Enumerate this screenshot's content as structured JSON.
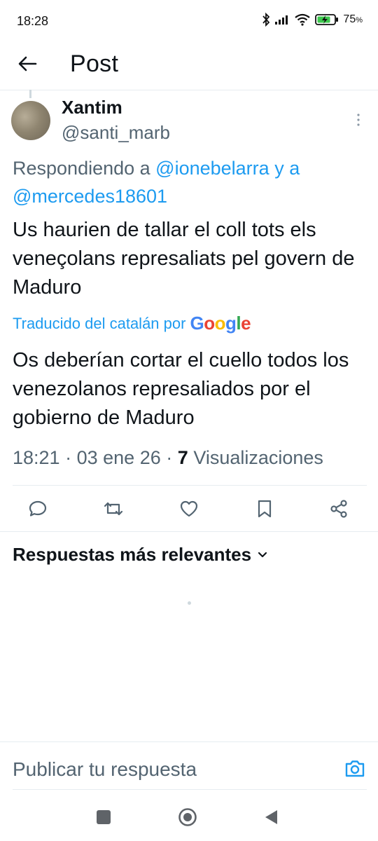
{
  "status_bar": {
    "time": "18:28",
    "battery": "75",
    "battery_unit": "%",
    "icons": [
      "bluetooth-icon",
      "signal-icon",
      "wifi-icon",
      "battery-charging-icon"
    ]
  },
  "header": {
    "title": "Post",
    "back_icon": "arrow-left-icon"
  },
  "post": {
    "author_name": "Xantim",
    "author_handle": "@santi_marb",
    "reply_prefix": "Respondiendo a ",
    "reply_mention_1": "@ionebelarra",
    "reply_joiner": " y a ",
    "reply_mention_2": "@mercedes18601",
    "text": "Us haurien de tallar el coll tots els veneçolans represaliats pel govern de Maduro",
    "translation_label": "Traducido del catalán por",
    "translation_provider": "Google",
    "translated_text": "Os deberían cortar el cuello todos los venezolanos represaliados por el gobierno de Maduro",
    "time": "18:21",
    "date": "03 ene 26",
    "views_count": "7",
    "views_label": "Visualizaciones",
    "separator": "·"
  },
  "actions": [
    "reply-icon",
    "retweet-icon",
    "like-icon",
    "bookmark-icon",
    "share-icon"
  ],
  "replies": {
    "sort_label": "Respuestas más relevantes"
  },
  "composer": {
    "placeholder": "Publicar tu respuesta"
  },
  "colors": {
    "accent": "#1d9bf0",
    "secondary_text": "#536471",
    "primary_text": "#0f1419",
    "divider": "#e6ecf0"
  }
}
